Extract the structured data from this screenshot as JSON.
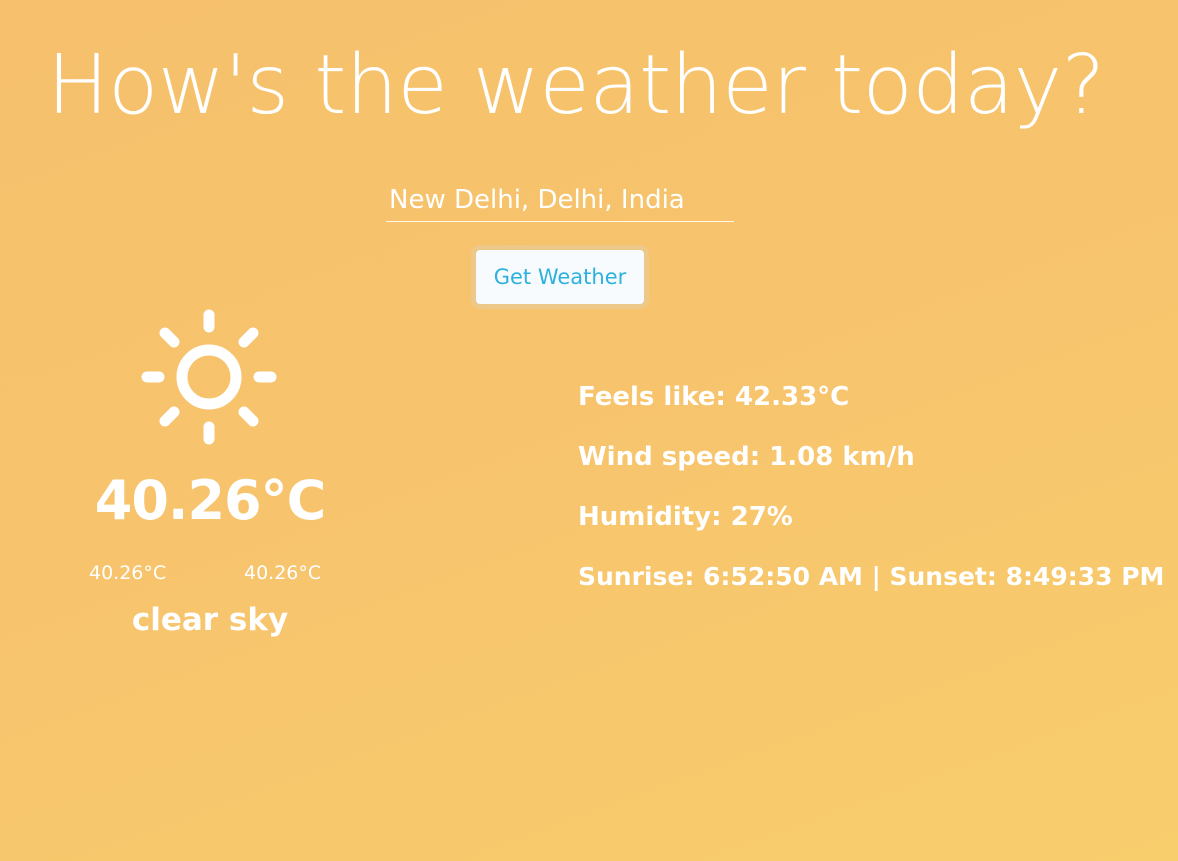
{
  "header": {
    "title": "How's the weather today?"
  },
  "search": {
    "value": "New Delhi, Delhi, India",
    "button_label": "Get Weather"
  },
  "weather": {
    "icon": "sun-icon",
    "temperature": "40.26°C",
    "temp_min": "40.26°C",
    "temp_max": "40.26°C",
    "description": "clear sky"
  },
  "details": {
    "feels_like": "Feels like: 42.33°C",
    "wind_speed": "Wind speed: 1.08 km/h",
    "humidity": "Humidity: 27%",
    "sun_times": "Sunrise: 6:52:50 AM | Sunset: 8:49:33 PM"
  },
  "colors": {
    "background": "#f7c36d",
    "button_text": "#2cb2dc",
    "button_background": "#f8fbfd",
    "text": "#ffffff"
  }
}
